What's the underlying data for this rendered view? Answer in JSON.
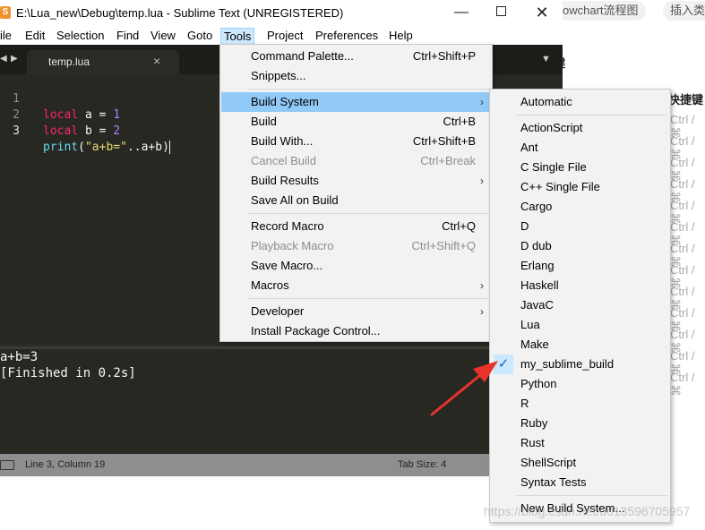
{
  "background_page": {
    "chip_1": "owchart流程图",
    "chip_2": "插入类",
    "heading_1": "键",
    "heading_2": "快捷键",
    "rows": [
      "Ctrl / ⌘",
      "Ctrl / ⌘",
      "Ctrl / ⌘",
      "Ctrl / ⌘",
      "Ctrl / ⌘",
      "Ctrl / ⌘",
      "Ctrl / ⌘",
      "Ctrl / ⌘",
      "Ctrl / ⌘",
      "Ctrl / ⌘",
      "Ctrl / ⌘",
      "Ctrl / ⌘",
      "Ctrl / ⌘"
    ]
  },
  "window": {
    "title": "E:\\Lua_new\\Debug\\temp.lua - Sublime Text (UNREGISTERED)",
    "min_glyph": "—",
    "close_glyph": "✕"
  },
  "menubar": [
    "ile",
    "Edit",
    "Selection",
    "Find",
    "View",
    "Goto",
    "Tools",
    "Project",
    "Preferences",
    "Help"
  ],
  "tab": {
    "label": "temp.lua",
    "close_glyph": "×"
  },
  "editor": {
    "line_numbers": [
      "1",
      "2",
      "3"
    ],
    "line1": {
      "kw": "local",
      "var": " a = ",
      "num": "1"
    },
    "line2": {
      "kw": "local",
      "var": " b = ",
      "num": "2"
    },
    "line3": {
      "fn": "print",
      "open": "(",
      "str": "\"a+b=\"",
      "concat": "..a+b",
      "close": ")"
    }
  },
  "output": {
    "line1": "a+b=3",
    "line2": "[Finished in 0.2s]"
  },
  "status": {
    "position": "Line 3, Column 19",
    "tab_size": "Tab Size: 4"
  },
  "tools_menu": {
    "items": [
      {
        "label": "Command Palette...",
        "shortcut": "Ctrl+Shift+P"
      },
      {
        "label": "Snippets...",
        "shortcut": ""
      },
      {
        "label": "Build System",
        "shortcut": ""
      },
      {
        "label": "Build",
        "shortcut": "Ctrl+B"
      },
      {
        "label": "Build With...",
        "shortcut": "Ctrl+Shift+B"
      },
      {
        "label": "Cancel Build",
        "shortcut": "Ctrl+Break"
      },
      {
        "label": "Build Results",
        "shortcut": ""
      },
      {
        "label": "Save All on Build",
        "shortcut": ""
      },
      {
        "label": "Record Macro",
        "shortcut": "Ctrl+Q"
      },
      {
        "label": "Playback Macro",
        "shortcut": "Ctrl+Shift+Q"
      },
      {
        "label": "Save Macro...",
        "shortcut": ""
      },
      {
        "label": "Macros",
        "shortcut": ""
      },
      {
        "label": "Developer",
        "shortcut": ""
      },
      {
        "label": "Install Package Control...",
        "shortcut": ""
      }
    ]
  },
  "build_menu": {
    "items": [
      "Automatic",
      "ActionScript",
      "Ant",
      "C Single File",
      "C++ Single File",
      "Cargo",
      "D",
      "D dub",
      "Erlang",
      "Haskell",
      "JavaC",
      "Lua",
      "Make",
      "my_sublime_build",
      "Python",
      "R",
      "Ruby",
      "Rust",
      "ShellScript",
      "Syntax Tests",
      "New Build System..."
    ],
    "checked": "my_sublime_build"
  },
  "colors": {
    "editor_bg": "#272822",
    "keyword": "#f92672",
    "number": "#ae81ff",
    "function": "#66d9ef",
    "string": "#e6db74",
    "menu_highlight": "#91c9f7",
    "annotation_arrow": "#e8332a"
  },
  "watermark": "https://blog.csdn.net/u013596705957"
}
